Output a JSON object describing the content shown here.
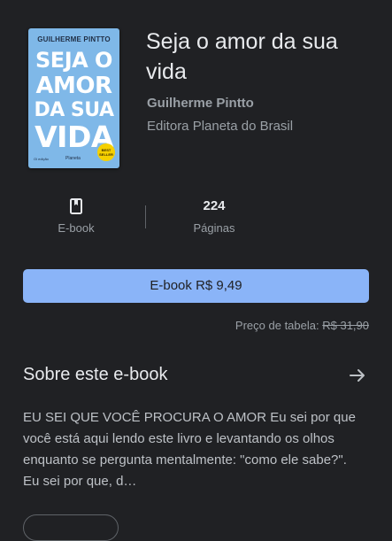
{
  "book": {
    "title": "Seja o amor da sua vida",
    "author": "Guilherme Pintto",
    "publisher": "Editora Planeta do Brasil",
    "cover": {
      "author": "GUILHERME PINTTO",
      "title_lines": [
        "SEJA O",
        "AMOR",
        "DA SUA",
        "VIDA"
      ],
      "badge": "BEST SELLER",
      "publisher_logo": "Planeta",
      "edition_mark": "Oi edição",
      "background_color": "#7fb8e8"
    }
  },
  "stats": {
    "format": {
      "icon": "bookmark-book-icon",
      "label": "E-book"
    },
    "pages": {
      "value": "224",
      "label": "Páginas"
    }
  },
  "buy_button": {
    "label": "E-book R$ 9,49",
    "color": "#8ab4f8"
  },
  "list_price": {
    "label": "Preço de tabela:",
    "value": "R$ 31,90"
  },
  "about": {
    "title": "Sobre este e-book",
    "arrow_icon": "arrow-right-icon",
    "description": "EU SEI QUE VOCÊ PROCURA O AMOR Eu sei por que você está aqui lendo este livro e levantando os olhos enquanto se pergunta mentalmente: \"como ele sabe?\". Eu sei por que, d…"
  }
}
